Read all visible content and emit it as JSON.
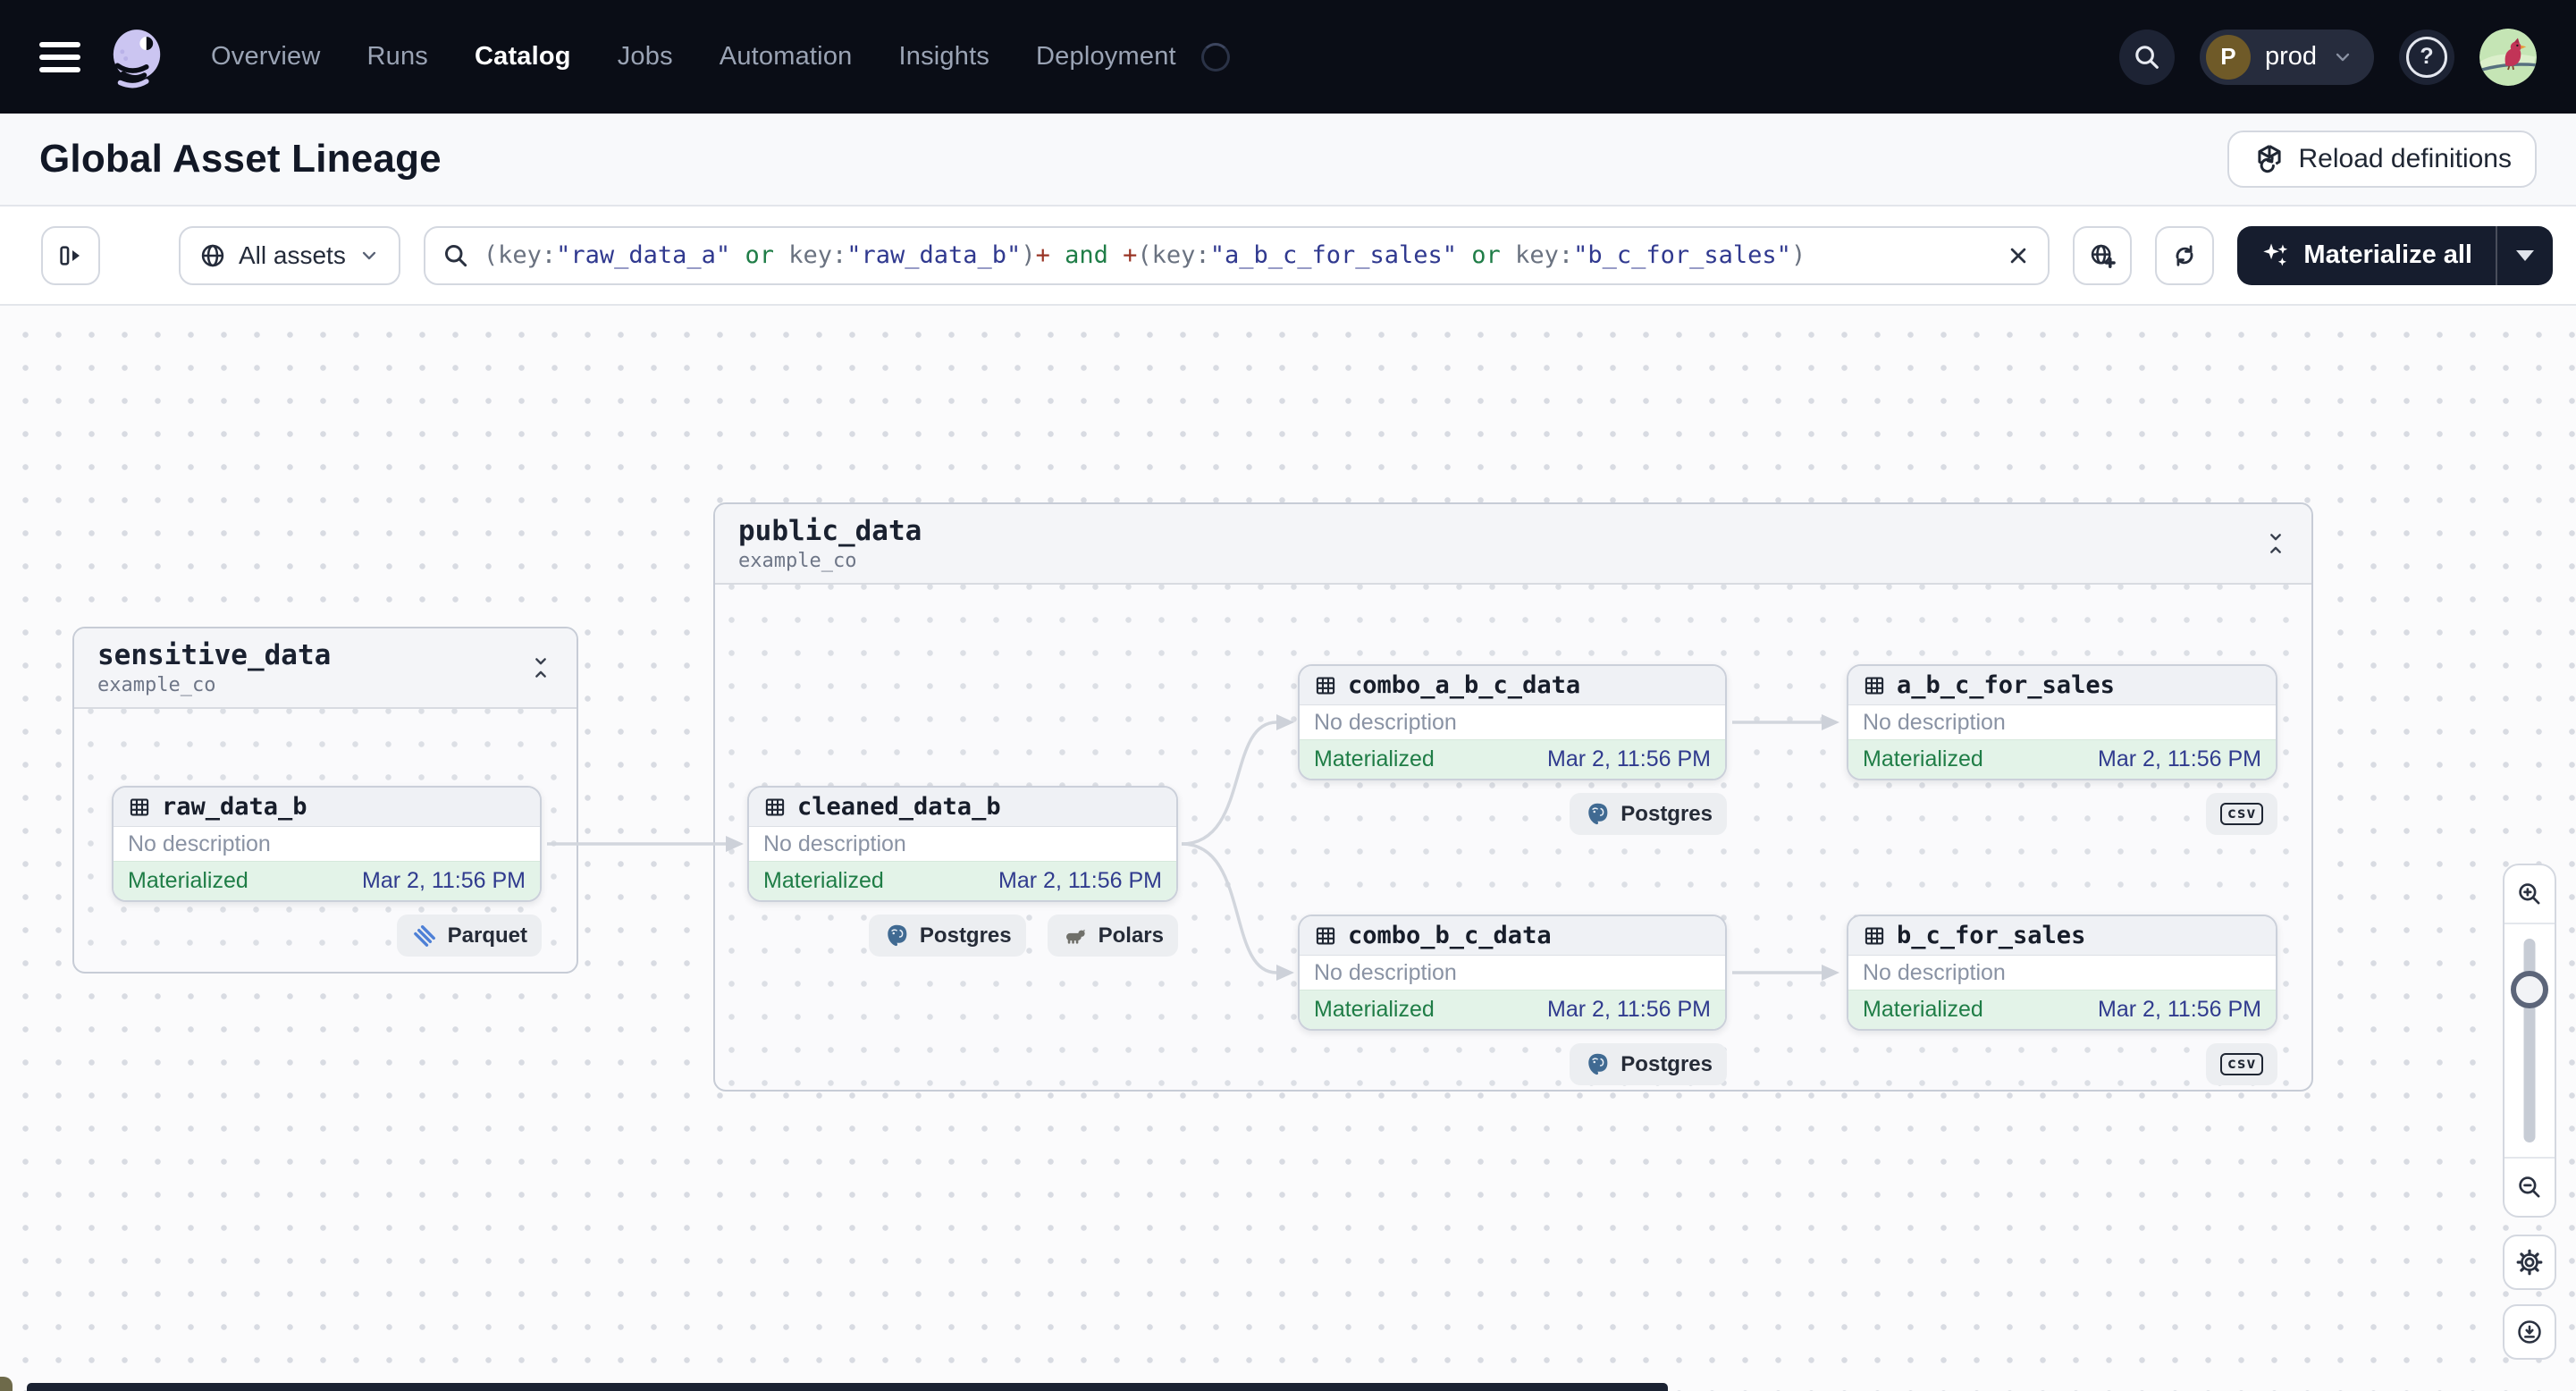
{
  "nav": {
    "items": [
      {
        "label": "Overview",
        "active": false
      },
      {
        "label": "Runs",
        "active": false
      },
      {
        "label": "Catalog",
        "active": true
      },
      {
        "label": "Jobs",
        "active": false
      },
      {
        "label": "Automation",
        "active": false
      },
      {
        "label": "Insights",
        "active": false
      },
      {
        "label": "Deployment",
        "active": false
      }
    ],
    "env": {
      "badge": "P",
      "name": "prod"
    },
    "help_glyph": "?"
  },
  "header": {
    "title": "Global Asset Lineage",
    "reload_label": "Reload definitions"
  },
  "toolbar": {
    "scope_label": "All assets",
    "materialize_label": "Materialize all",
    "query": {
      "tokens": [
        {
          "text": "(key:",
          "type": "plain"
        },
        {
          "text": "\"raw_data_a\"",
          "type": "string"
        },
        {
          "text": " or ",
          "type": "op"
        },
        {
          "text": "key:",
          "type": "plain"
        },
        {
          "text": "\"raw_data_b\"",
          "type": "string"
        },
        {
          "text": ")",
          "type": "plain"
        },
        {
          "text": "+",
          "type": "plus"
        },
        {
          "text": " and ",
          "type": "op"
        },
        {
          "text": "+",
          "type": "plus"
        },
        {
          "text": "(key:",
          "type": "plain"
        },
        {
          "text": "\"a_b_c_for_sales\"",
          "type": "string"
        },
        {
          "text": " or ",
          "type": "op"
        },
        {
          "text": "key:",
          "type": "plain"
        },
        {
          "text": "\"b_c_for_sales\"",
          "type": "string"
        },
        {
          "text": ")",
          "type": "plain"
        }
      ]
    }
  },
  "graph": {
    "groups": [
      {
        "name": "sensitive_data",
        "location": "example_co"
      },
      {
        "name": "public_data",
        "location": "example_co"
      }
    ],
    "nodes": [
      {
        "name": "raw_data_b",
        "description": "No description",
        "status": "Materialized",
        "timestamp": "Mar 2, 11:56 PM",
        "tags": [
          {
            "label": "Parquet",
            "icon": "parquet-icon"
          }
        ]
      },
      {
        "name": "cleaned_data_b",
        "description": "No description",
        "status": "Materialized",
        "timestamp": "Mar 2, 11:56 PM",
        "tags": [
          {
            "label": "Postgres",
            "icon": "postgres-icon"
          },
          {
            "label": "Polars",
            "icon": "polars-icon"
          }
        ]
      },
      {
        "name": "combo_a_b_c_data",
        "description": "No description",
        "status": "Materialized",
        "timestamp": "Mar 2, 11:56 PM",
        "tags": [
          {
            "label": "Postgres",
            "icon": "postgres-icon"
          }
        ]
      },
      {
        "name": "a_b_c_for_sales",
        "description": "No description",
        "status": "Materialized",
        "timestamp": "Mar 2, 11:56 PM",
        "tags": [
          {
            "label": "csv",
            "icon": "csv-icon"
          }
        ]
      },
      {
        "name": "combo_b_c_data",
        "description": "No description",
        "status": "Materialized",
        "timestamp": "Mar 2, 11:56 PM",
        "tags": [
          {
            "label": "Postgres",
            "icon": "postgres-icon"
          }
        ]
      },
      {
        "name": "b_c_for_sales",
        "description": "No description",
        "status": "Materialized",
        "timestamp": "Mar 2, 11:56 PM",
        "tags": [
          {
            "label": "csv",
            "icon": "csv-icon"
          }
        ]
      }
    ]
  },
  "icons": {
    "menu": "hamburger",
    "logo": "dagster-octopus",
    "search": "magnifier",
    "help": "question-circle",
    "env_chevron": "chevron-down",
    "avatar": "cardinal-bird",
    "reload": "cube-refresh",
    "panel_toggle": "panel-expand",
    "scope_globe": "globe",
    "scope_chevron": "chevron-down",
    "query_search": "magnifier",
    "query_clear": "x",
    "graph_globe": "globe-plus",
    "refresh": "sync-arrows",
    "materialize": "sparkles",
    "materialize_caret": "caret-down",
    "asset": "table-grid",
    "collapse": "collapse-chevrons",
    "zoom_in": "magnifier-plus",
    "zoom_out": "magnifier-minus",
    "settings": "gear",
    "download": "download-circle"
  },
  "colors": {
    "nav_bg": "#0A0D16",
    "accent_dark": "#161D2E",
    "materialized_green": "#1F7D46",
    "materialized_bg": "#E3F3E8",
    "timestamp_navy": "#303B8E",
    "query_string": "#30398F",
    "query_operator": "#1F7D47",
    "query_plus": "#993425",
    "edge_gray": "#D2D6DD"
  }
}
